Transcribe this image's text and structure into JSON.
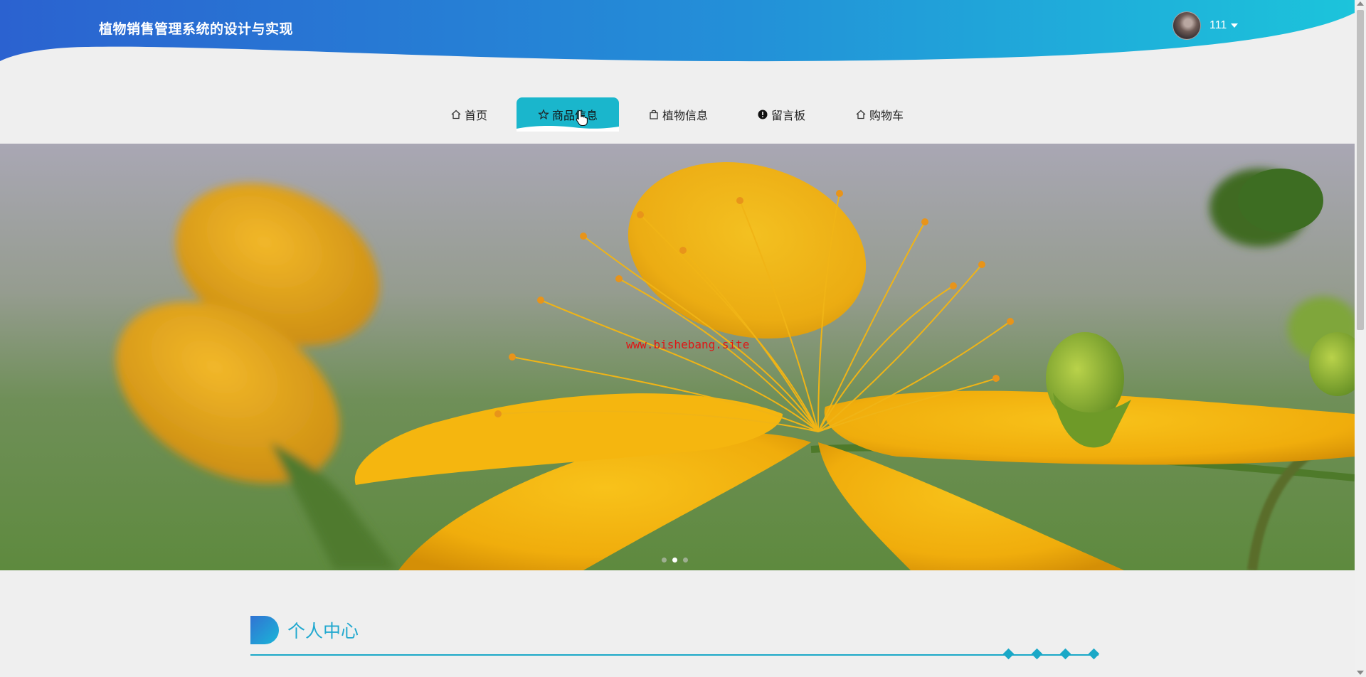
{
  "header": {
    "site_title": "植物销售管理系统的设计与实现",
    "username": "111"
  },
  "nav": {
    "items": [
      {
        "label": "首页",
        "icon": "home-icon"
      },
      {
        "label": "商品信息",
        "icon": "star-icon",
        "active": true
      },
      {
        "label": "植物信息",
        "icon": "bag-icon"
      },
      {
        "label": "留言板",
        "icon": "alert-icon"
      },
      {
        "label": "购物车",
        "icon": "cart-home-icon"
      }
    ]
  },
  "banner": {
    "watermark": "www.bishebang.site",
    "slide_count": 3,
    "active_slide": 2
  },
  "section": {
    "title": "个人中心"
  },
  "colors": {
    "header_gradient_start": "#2b62d0",
    "header_gradient_end": "#22c0d8",
    "accent": "#1ab6cc",
    "section_accent": "#1aa8c7"
  }
}
